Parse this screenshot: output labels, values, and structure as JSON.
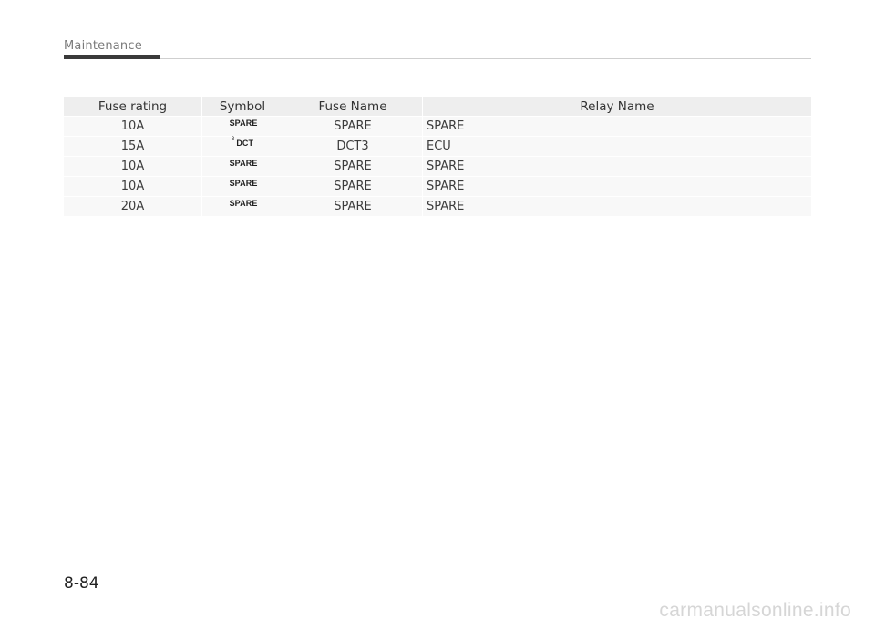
{
  "header": {
    "section_title": "Maintenance"
  },
  "table": {
    "columns": [
      "Fuse rating",
      "Symbol",
      "Fuse Name",
      "Relay Name"
    ],
    "rows": [
      {
        "rating": "10A",
        "symbol_sup": "",
        "symbol": "SPARE",
        "fuse_name": "SPARE",
        "relay_name": "SPARE"
      },
      {
        "rating": "15A",
        "symbol_sup": "3",
        "symbol": "DCT",
        "fuse_name": "DCT3",
        "relay_name": "ECU"
      },
      {
        "rating": "10A",
        "symbol_sup": "",
        "symbol": "SPARE",
        "fuse_name": "SPARE",
        "relay_name": "SPARE"
      },
      {
        "rating": "10A",
        "symbol_sup": "",
        "symbol": "SPARE",
        "fuse_name": "SPARE",
        "relay_name": "SPARE"
      },
      {
        "rating": "20A",
        "symbol_sup": "",
        "symbol": "SPARE",
        "fuse_name": "SPARE",
        "relay_name": "SPARE"
      }
    ]
  },
  "footer": {
    "page_number": "8-84",
    "watermark": "carmanualsonline.info"
  }
}
